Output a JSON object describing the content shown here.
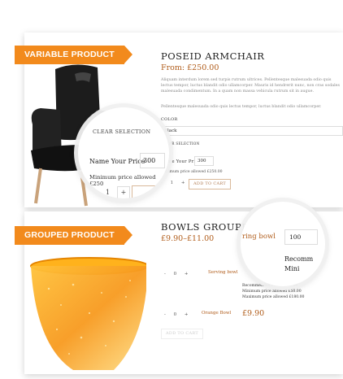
{
  "variable": {
    "banner": "VARIABLE PRODUCT",
    "title": "POSEID ARMCHAIR",
    "price": "From: £250.00",
    "desc1": "Aliquam interdum lorem sed turpis rutrum ultrices. Pellentesque malesuada odio quis lectus tempor, luctus blandit odio ullamcorper. Mauris id hendrerit nunc, non cras sodales malesuada condimentum. In a quam non massa vehicula rutrum sit in augue.",
    "desc2": "Pellentesque malesuada odio quis lectus tempor, luctus blandit odio ullamcorper.",
    "color_label": "COLOR",
    "color_value": "Black",
    "clear_selection": "CLEAR SELECTION",
    "name_price_label": "Name Your Price",
    "name_price_value": "300",
    "min_price": "Minimum price allowed £250.00",
    "add_to_cart": "ADD TO CART",
    "qty": "1",
    "mag": {
      "clear": "CLEAR SELECTION",
      "name_price_label": "Name Your Price",
      "name_price_value": "300",
      "min_price": "Minimum price allowed £250",
      "qty": "1",
      "plus": "+"
    }
  },
  "grouped": {
    "banner": "GROUPED PRODUCT",
    "title": "BOWLS GROUPED",
    "price": "£9.90–£11.00",
    "item1_name": "Serving bowl",
    "item1_qty": "0",
    "item1_rec": "Recommended Price £100.00",
    "item1_min": "Minimum price allowed £50.00",
    "item1_max": "Maximum price allowed £180.00",
    "item2_name": "Orange Bowl",
    "item2_qty": "0",
    "item2_price": "£9.90",
    "add_to_cart": "ADD TO CART",
    "mag": {
      "name": "ring bowl",
      "value": "100",
      "rec": "Recomm",
      "mini": "Mini"
    }
  },
  "colors": {
    "accent": "#f28a1c",
    "price": "#b05c1a"
  }
}
